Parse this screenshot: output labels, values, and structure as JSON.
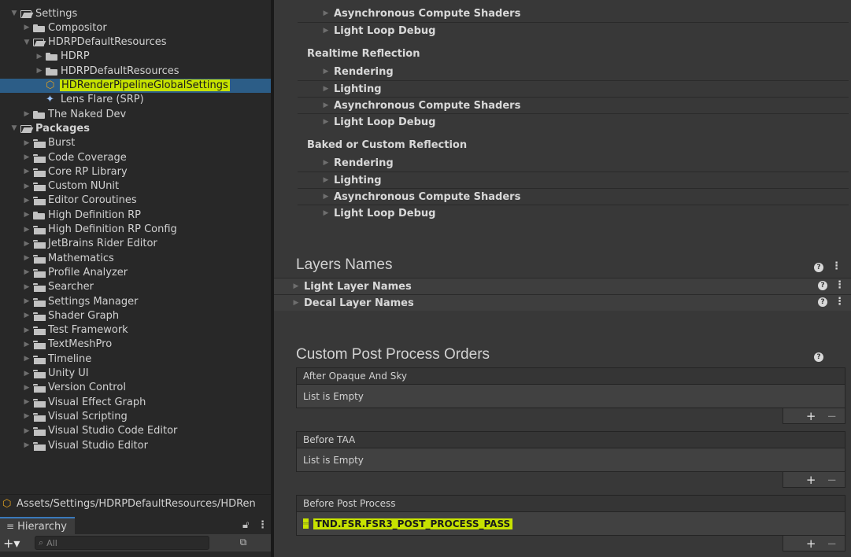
{
  "project_tree": [
    {
      "label": "Settings",
      "depth": 0,
      "expanded": true,
      "icon": "folder-open-icon",
      "bold": false
    },
    {
      "label": "Compositor",
      "depth": 1,
      "expanded": false,
      "icon": "folder-icon",
      "bold": false
    },
    {
      "label": "HDRPDefaultResources",
      "depth": 1,
      "expanded": true,
      "icon": "folder-open-icon",
      "bold": false
    },
    {
      "label": "HDRP",
      "depth": 2,
      "expanded": false,
      "icon": "folder-icon",
      "bold": false
    },
    {
      "label": "HDRPDefaultResources",
      "depth": 2,
      "expanded": false,
      "icon": "folder-icon",
      "bold": false
    },
    {
      "label": "HDRenderPipelineGlobalSettings",
      "depth": 2,
      "expanded": null,
      "icon": "asset-icon",
      "bold": false,
      "selected": true,
      "highlighted": true
    },
    {
      "label": "Lens Flare (SRP)",
      "depth": 2,
      "expanded": null,
      "icon": "lens-flare-icon",
      "bold": false
    },
    {
      "label": "The Naked Dev",
      "depth": 1,
      "expanded": false,
      "icon": "folder-icon",
      "bold": false
    },
    {
      "label": "Packages",
      "depth": 0,
      "expanded": true,
      "icon": "folder-open-icon",
      "bold": true
    },
    {
      "label": "Burst",
      "depth": 1,
      "expanded": false,
      "icon": "package-folder-icon"
    },
    {
      "label": "Code Coverage",
      "depth": 1,
      "expanded": false,
      "icon": "package-folder-icon"
    },
    {
      "label": "Core RP Library",
      "depth": 1,
      "expanded": false,
      "icon": "package-folder-icon"
    },
    {
      "label": "Custom NUnit",
      "depth": 1,
      "expanded": false,
      "icon": "package-folder-icon"
    },
    {
      "label": "Editor Coroutines",
      "depth": 1,
      "expanded": false,
      "icon": "package-folder-icon"
    },
    {
      "label": "High Definition RP",
      "depth": 1,
      "expanded": false,
      "icon": "folder-icon"
    },
    {
      "label": "High Definition RP Config",
      "depth": 1,
      "expanded": false,
      "icon": "package-folder-icon"
    },
    {
      "label": "JetBrains Rider Editor",
      "depth": 1,
      "expanded": false,
      "icon": "package-folder-icon"
    },
    {
      "label": "Mathematics",
      "depth": 1,
      "expanded": false,
      "icon": "package-folder-icon"
    },
    {
      "label": "Profile Analyzer",
      "depth": 1,
      "expanded": false,
      "icon": "package-folder-icon"
    },
    {
      "label": "Searcher",
      "depth": 1,
      "expanded": false,
      "icon": "package-folder-icon"
    },
    {
      "label": "Settings Manager",
      "depth": 1,
      "expanded": false,
      "icon": "package-folder-icon"
    },
    {
      "label": "Shader Graph",
      "depth": 1,
      "expanded": false,
      "icon": "package-folder-icon"
    },
    {
      "label": "Test Framework",
      "depth": 1,
      "expanded": false,
      "icon": "package-folder-icon"
    },
    {
      "label": "TextMeshPro",
      "depth": 1,
      "expanded": false,
      "icon": "package-folder-icon"
    },
    {
      "label": "Timeline",
      "depth": 1,
      "expanded": false,
      "icon": "package-folder-icon"
    },
    {
      "label": "Unity UI",
      "depth": 1,
      "expanded": false,
      "icon": "package-folder-icon"
    },
    {
      "label": "Version Control",
      "depth": 1,
      "expanded": false,
      "icon": "package-folder-icon"
    },
    {
      "label": "Visual Effect Graph",
      "depth": 1,
      "expanded": false,
      "icon": "package-folder-icon"
    },
    {
      "label": "Visual Scripting",
      "depth": 1,
      "expanded": false,
      "icon": "package-folder-icon"
    },
    {
      "label": "Visual Studio Code Editor",
      "depth": 1,
      "expanded": false,
      "icon": "package-folder-icon"
    },
    {
      "label": "Visual Studio Editor",
      "depth": 1,
      "expanded": false,
      "icon": "package-folder-icon"
    }
  ],
  "path_bar": {
    "text": "Assets/Settings/HDRPDefaultResources/HDRen"
  },
  "hierarchy": {
    "tab_label": "Hierarchy",
    "search_placeholder": "All"
  },
  "inspector": {
    "top_foldouts": [
      "Asynchronous Compute Shaders",
      "Light Loop Debug"
    ],
    "realtime_reflection": {
      "title": "Realtime Reflection",
      "foldouts": [
        "Rendering",
        "Lighting",
        "Asynchronous Compute Shaders",
        "Light Loop Debug"
      ]
    },
    "baked_reflection": {
      "title": "Baked or Custom Reflection",
      "foldouts": [
        "Rendering",
        "Lighting",
        "Asynchronous Compute Shaders",
        "Light Loop Debug"
      ]
    },
    "layers_names": {
      "title": "Layers Names",
      "rows": [
        "Light Layer Names",
        "Decal Layer Names"
      ]
    },
    "custom_post_process": {
      "title": "Custom Post Process Orders",
      "lists": [
        {
          "header": "After Opaque And Sky",
          "empty_text": "List is Empty",
          "items": []
        },
        {
          "header": "Before TAA",
          "empty_text": "List is Empty",
          "items": []
        },
        {
          "header": "Before Post Process",
          "empty_text": "",
          "items": [
            "TND.FSR.FSR3_POST_PROCESS_PASS"
          ]
        }
      ]
    }
  },
  "colors": {
    "selection": "#2c5d87",
    "highlight": "#c7e200",
    "panel_bg": "#282828",
    "inspector_bg": "#383838"
  }
}
